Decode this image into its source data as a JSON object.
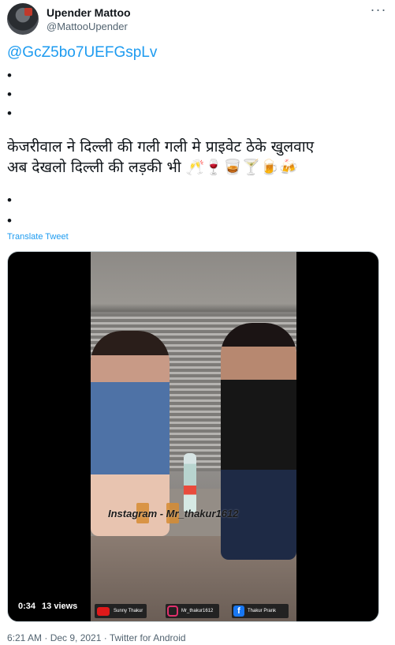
{
  "user": {
    "name": "Upender Mattoo",
    "handle": "@MattooUpender"
  },
  "tweet": {
    "mention": "@GcZ5bo7UEFGspLv",
    "bullet": "•",
    "text": "केजरीवाल ने दिल्ली की गली गली मे प्राइवेट ठेके खुलवाए\nअब देखलो दिल्ली की लड़की भी 🥂🍷🥃🍸🍺🍻",
    "translate_label": "Translate Tweet"
  },
  "media": {
    "watermark": "Instagram - Mr_thakur1612",
    "duration": "0:34",
    "views": "13 views",
    "tags": {
      "youtube": "Sunny Thakur",
      "instagram": "Mr_thakur1612",
      "facebook": "Thakur Prank"
    },
    "facebook_glyph": "f"
  },
  "meta": {
    "timestamp": "6:21 AM · Dec 9, 2021 · Twitter for Android"
  },
  "icons": {
    "more": "more-horizontal-icon"
  }
}
